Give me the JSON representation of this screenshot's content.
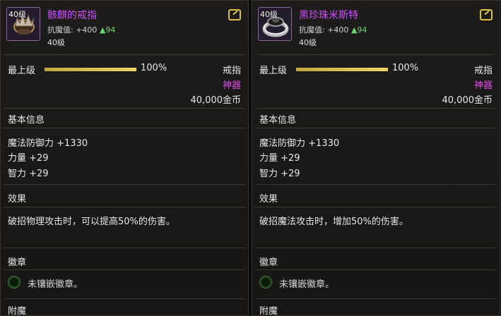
{
  "left": {
    "level_tag": "40级",
    "name": "骸麒的戒指",
    "resist_label": "抗魔值:",
    "resist_value": "+400",
    "resist_bonus": "▲94",
    "level": "40级",
    "grade_label": "最上级",
    "grade_fraction": 1.0,
    "grade_pct": "100%",
    "item_type": "戒指",
    "rarity": "神器",
    "price": "40,000金币",
    "basic_info": "基本信息",
    "stats": [
      "魔法防御力 +1330",
      "力量 +29",
      "智力 +29"
    ],
    "effect_title": "效果",
    "effect_text": "破招物理攻击时，可以提高50%的伤害。",
    "emblem_title": "徽章",
    "emblem_text": "未镶嵌徽章。",
    "enchant_title": "附魔",
    "icon": "dark-claw-ring-icon"
  },
  "right": {
    "level_tag": "40级",
    "name": "黑珍珠米斯特",
    "resist_label": "抗魔值:",
    "resist_value": "+400",
    "resist_bonus": "▲94",
    "level": "40级",
    "grade_label": "最上级",
    "grade_fraction": 1.0,
    "grade_pct": "100%",
    "item_type": "戒指",
    "rarity": "神器",
    "price": "40,000金币",
    "basic_info": "基本信息",
    "stats": [
      "魔法防御力 +1330",
      "力量 +29",
      "智力 +29"
    ],
    "effect_title": "效果",
    "effect_text": "破招魔法攻击时，增加50%的伤害。",
    "emblem_title": "徽章",
    "emblem_text": "未镶嵌徽章。",
    "enchant_title": "附魔",
    "icon": "black-pearl-ring-icon"
  },
  "colors": {
    "name": "#d050ff",
    "rarity": "#e04ce8",
    "bonus": "#6fd66f",
    "grade_bar": "#e0c25a"
  }
}
